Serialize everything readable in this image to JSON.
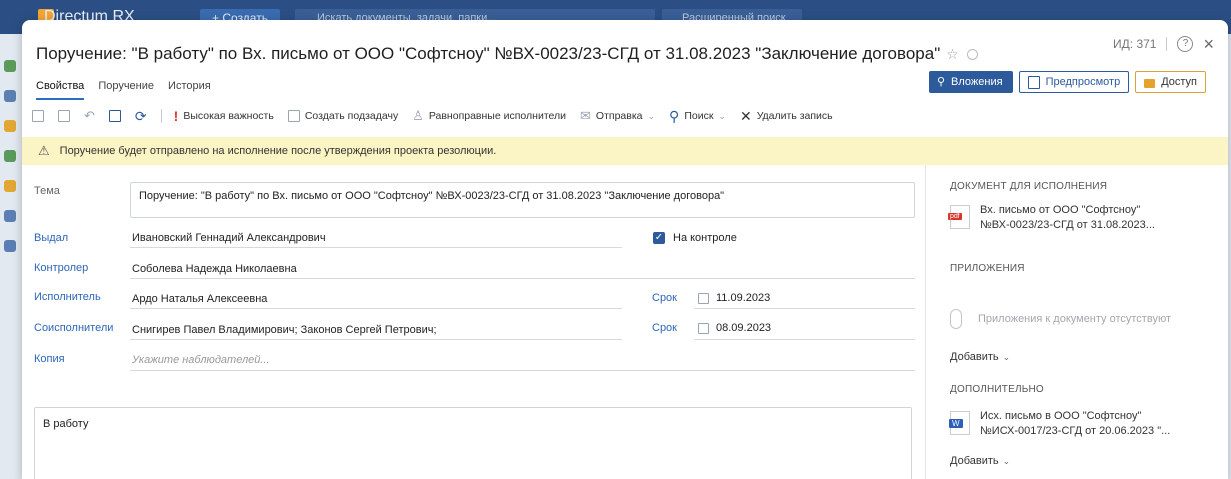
{
  "background": {
    "app_title": "Directum RX",
    "create_label": "+ Создать",
    "search_placeholder": "Искать документы, задачи, папки...",
    "adv_search_label": "Расширенный поиск"
  },
  "dialog": {
    "title": "Поручение: \"В работу\" по Вх. письмо от ООО \"Софтсноу\" №ВХ-0023/23-СГД от 31.08.2023 \"Заключение договора\"",
    "id_label": "ИД: 371",
    "tabs": [
      "Свойства",
      "Поручение",
      "История"
    ],
    "buttons": {
      "attachments": "Вложения",
      "preview": "Предпросмотр",
      "access": "Доступ"
    },
    "toolbar": {
      "high_importance": "Высокая важность",
      "create_subtask": "Создать подзадачу",
      "equal_performers": "Равноправные исполнители",
      "send": "Отправка",
      "search": "Поиск",
      "delete_record": "Удалить запись"
    },
    "banner": "Поручение будет отправлено на исполнение после утверждения проекта резолюции."
  },
  "form": {
    "subject_label": "Тема",
    "subject_value": "Поручение: \"В работу\" по Вх. письмо от ООО \"Софтсноу\" №ВХ-0023/23-СГД от 31.08.2023 \"Заключение договора\"",
    "issued_label": "Выдал",
    "issued_value": "Ивановский Геннадий Александрович",
    "on_control_label": "На контроле",
    "controller_label": "Контролер",
    "controller_value": "Соболева Надежда Николаевна",
    "performer_label": "Исполнитель",
    "performer_value": "Ардо Наталья Алексеевна",
    "deadline_label": "Срок",
    "performer_deadline": "11.09.2023",
    "coperformers_label": "Соисполнители",
    "coperformers_value": "Снигирев Павел Владимирович; Законов Сергей Петрович;",
    "coperformers_deadline": "08.09.2023",
    "copy_label": "Копия",
    "copy_placeholder": "Укажите наблюдателей...",
    "text_value": "В работу"
  },
  "panel": {
    "doc_section": "ДОКУМЕНТ ДЛЯ ИСПОЛНЕНИЯ",
    "doc_line1": "Вх. письмо от ООО \"Софтсноу\"",
    "doc_line2": "№ВХ-0023/23-СГД от 31.08.2023...",
    "attachments_section": "ПРИЛОЖЕНИЯ",
    "no_attachments": "Приложения к документу отсутствуют",
    "add_label": "Добавить",
    "extra_section": "ДОПОЛНИТЕЛЬНО",
    "extra_line1": "Исх. письмо в ООО \"Софтсноу\"",
    "extra_line2": "№ИСХ-0017/23-СГД от 20.06.2023 \"...",
    "add_label_2": "Добавить"
  },
  "colors": {
    "accent": "#2c5a9b",
    "link": "#2c66b8",
    "banner_bg": "#fbf4c4",
    "pdf_red": "#d8342a",
    "word_blue": "#2b5fb8"
  }
}
